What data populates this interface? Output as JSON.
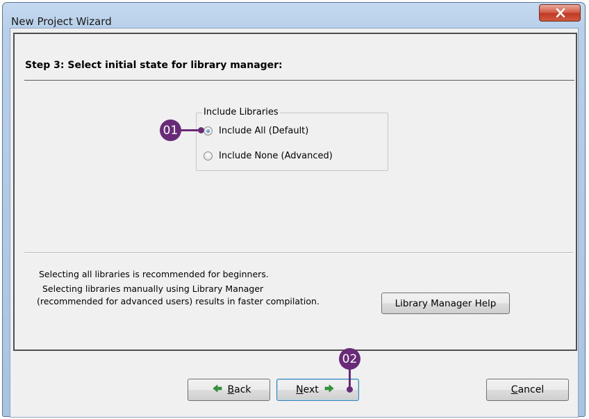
{
  "window": {
    "title": "New Project Wizard"
  },
  "step": {
    "title": "Step 3: Select initial state for library manager:"
  },
  "include_libraries": {
    "legend": "Include Libraries",
    "options": [
      {
        "label": "Include All (Default)",
        "selected": true
      },
      {
        "label": "Include None (Advanced)",
        "selected": false
      }
    ]
  },
  "info": {
    "line1": "Selecting all libraries is recommended for beginners.",
    "line2": "Selecting libraries manually using Library Manager",
    "line3": "(recommended for advanced users) results in faster compilation."
  },
  "buttons": {
    "library_manager_help": "Library Manager Help",
    "back_mnemonic": "B",
    "back_rest": "ack",
    "next_mnemonic": "N",
    "next_rest": "ext",
    "cancel_mnemonic": "C",
    "cancel_rest": "ancel"
  },
  "callouts": {
    "c1": "01",
    "c2": "02"
  },
  "icons": {
    "close": "close-icon",
    "back": "arrow-left-icon",
    "next": "arrow-right-icon"
  },
  "colors": {
    "callout": "#6a2a7a",
    "arrow_green": "#2f9a3a",
    "close_red": "#c23a22"
  }
}
